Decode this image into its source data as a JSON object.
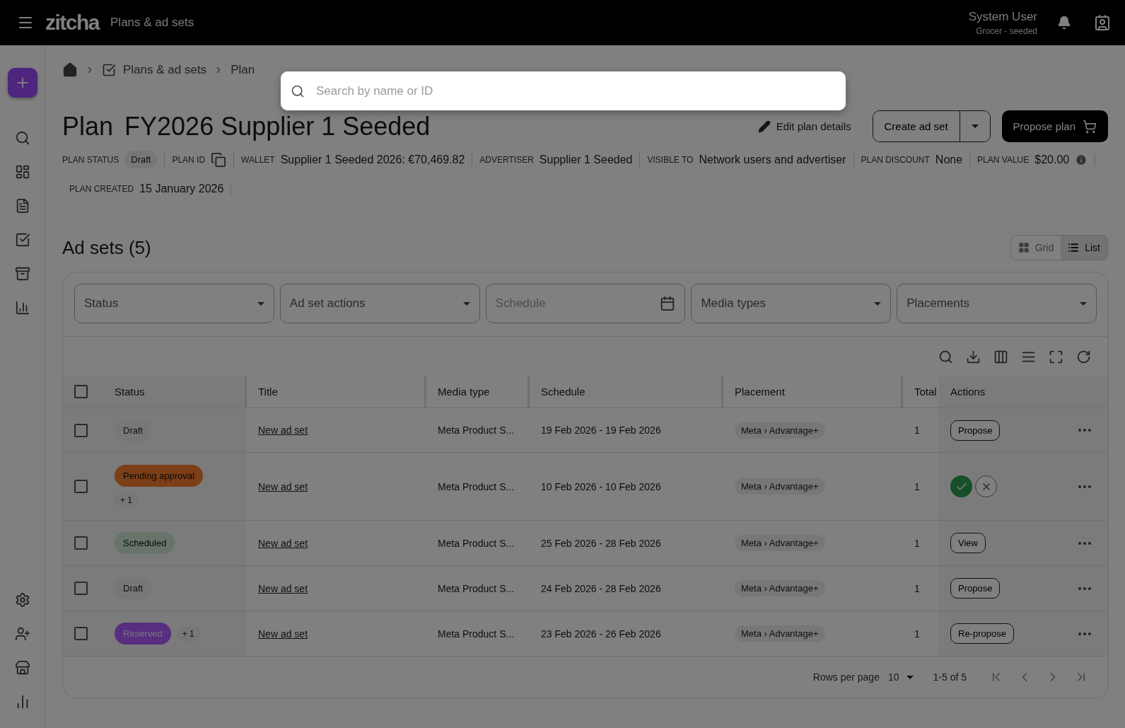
{
  "topbar": {
    "logo": "zitcha",
    "section": "Plans & ad sets",
    "user_name": "System User",
    "user_org": "Grocer - seeded"
  },
  "breadcrumbs": [
    "Plans & ad sets",
    "Plan"
  ],
  "title": {
    "prefix": "Plan",
    "name": "FY2026 Supplier 1 Seeded"
  },
  "header_actions": {
    "edit": "Edit plan details",
    "create": "Create ad set",
    "propose": "Propose plan"
  },
  "meta": [
    {
      "kind": "chip",
      "label": "PLAN STATUS",
      "value": "Draft"
    },
    {
      "kind": "copy",
      "label": "PLAN ID"
    },
    {
      "kind": "text",
      "label": "WALLET",
      "value": "Supplier 1 Seeded 2026: €70,469.82"
    },
    {
      "kind": "text",
      "label": "ADVERTISER",
      "value": "Supplier 1 Seeded"
    },
    {
      "kind": "text",
      "label": "VISIBLE TO",
      "value": "Network users and advertiser"
    },
    {
      "kind": "text",
      "label": "PLAN DISCOUNT",
      "value": "None"
    },
    {
      "kind": "info",
      "label": "PLAN VALUE",
      "value": "$20.00"
    },
    {
      "kind": "text",
      "label": "PLAN CREATED",
      "value": "15 January 2026"
    }
  ],
  "ad_sets": {
    "heading": "Ad sets (5)",
    "views": [
      {
        "label": "Grid",
        "selected": false
      },
      {
        "label": "List",
        "selected": true
      }
    ]
  },
  "filters": [
    {
      "kind": "select",
      "placeholder": "Status"
    },
    {
      "kind": "select",
      "placeholder": "Ad set actions"
    },
    {
      "kind": "date",
      "placeholder": "Schedule"
    },
    {
      "kind": "select",
      "placeholder": "Media types"
    },
    {
      "kind": "select",
      "placeholder": "Placements"
    }
  ],
  "table": {
    "all_checked": false,
    "columns": [
      "Status",
      "Title",
      "Media type",
      "Schedule",
      "Placement",
      "Total",
      "Actions"
    ],
    "rows": [
      {
        "checked": false,
        "status": {
          "kind": "draft",
          "label": "Draft"
        },
        "title": "New ad set",
        "media_type": "Meta Product S...",
        "schedule": "19 Feb 2026 - 19 Feb 2026",
        "placement": "Meta › Advantage+",
        "total": "1",
        "action": {
          "kind": "button",
          "label": "Propose"
        }
      },
      {
        "checked": false,
        "status": {
          "kind": "pending",
          "label": "Pending approval"
        },
        "extra": "+ 1",
        "title": "New ad set",
        "media_type": "Meta Product S...",
        "schedule": "10 Feb 2026 - 10 Feb 2026",
        "placement": "Meta › Advantage+",
        "total": "1",
        "action": {
          "kind": "approve_reject"
        }
      },
      {
        "checked": false,
        "status": {
          "kind": "scheduled",
          "label": "Scheduled"
        },
        "title": "New ad set",
        "media_type": "Meta Product S...",
        "schedule": "25 Feb 2026 - 28 Feb 2026",
        "placement": "Meta › Advantage+",
        "total": "1",
        "action": {
          "kind": "button",
          "label": "View"
        }
      },
      {
        "checked": false,
        "status": {
          "kind": "draft",
          "label": "Draft"
        },
        "title": "New ad set",
        "media_type": "Meta Product S...",
        "schedule": "24 Feb 2026 - 28 Feb 2026",
        "placement": "Meta › Advantage+",
        "total": "1",
        "action": {
          "kind": "button",
          "label": "Propose"
        }
      },
      {
        "checked": false,
        "status": {
          "kind": "reserved",
          "label": "Reserved"
        },
        "extra": "+ 1",
        "title": "New ad set",
        "media_type": "Meta Product S...",
        "schedule": "23 Feb 2026 - 26 Feb 2026",
        "placement": "Meta › Advantage+",
        "total": "1",
        "action": {
          "kind": "button",
          "label": "Re-propose"
        }
      }
    ]
  },
  "pagination": {
    "rows_label": "Rows per page",
    "rows_value": "10",
    "range": "1-5 of 5"
  },
  "search_dialog": {
    "placeholder": "Search by name or ID"
  }
}
